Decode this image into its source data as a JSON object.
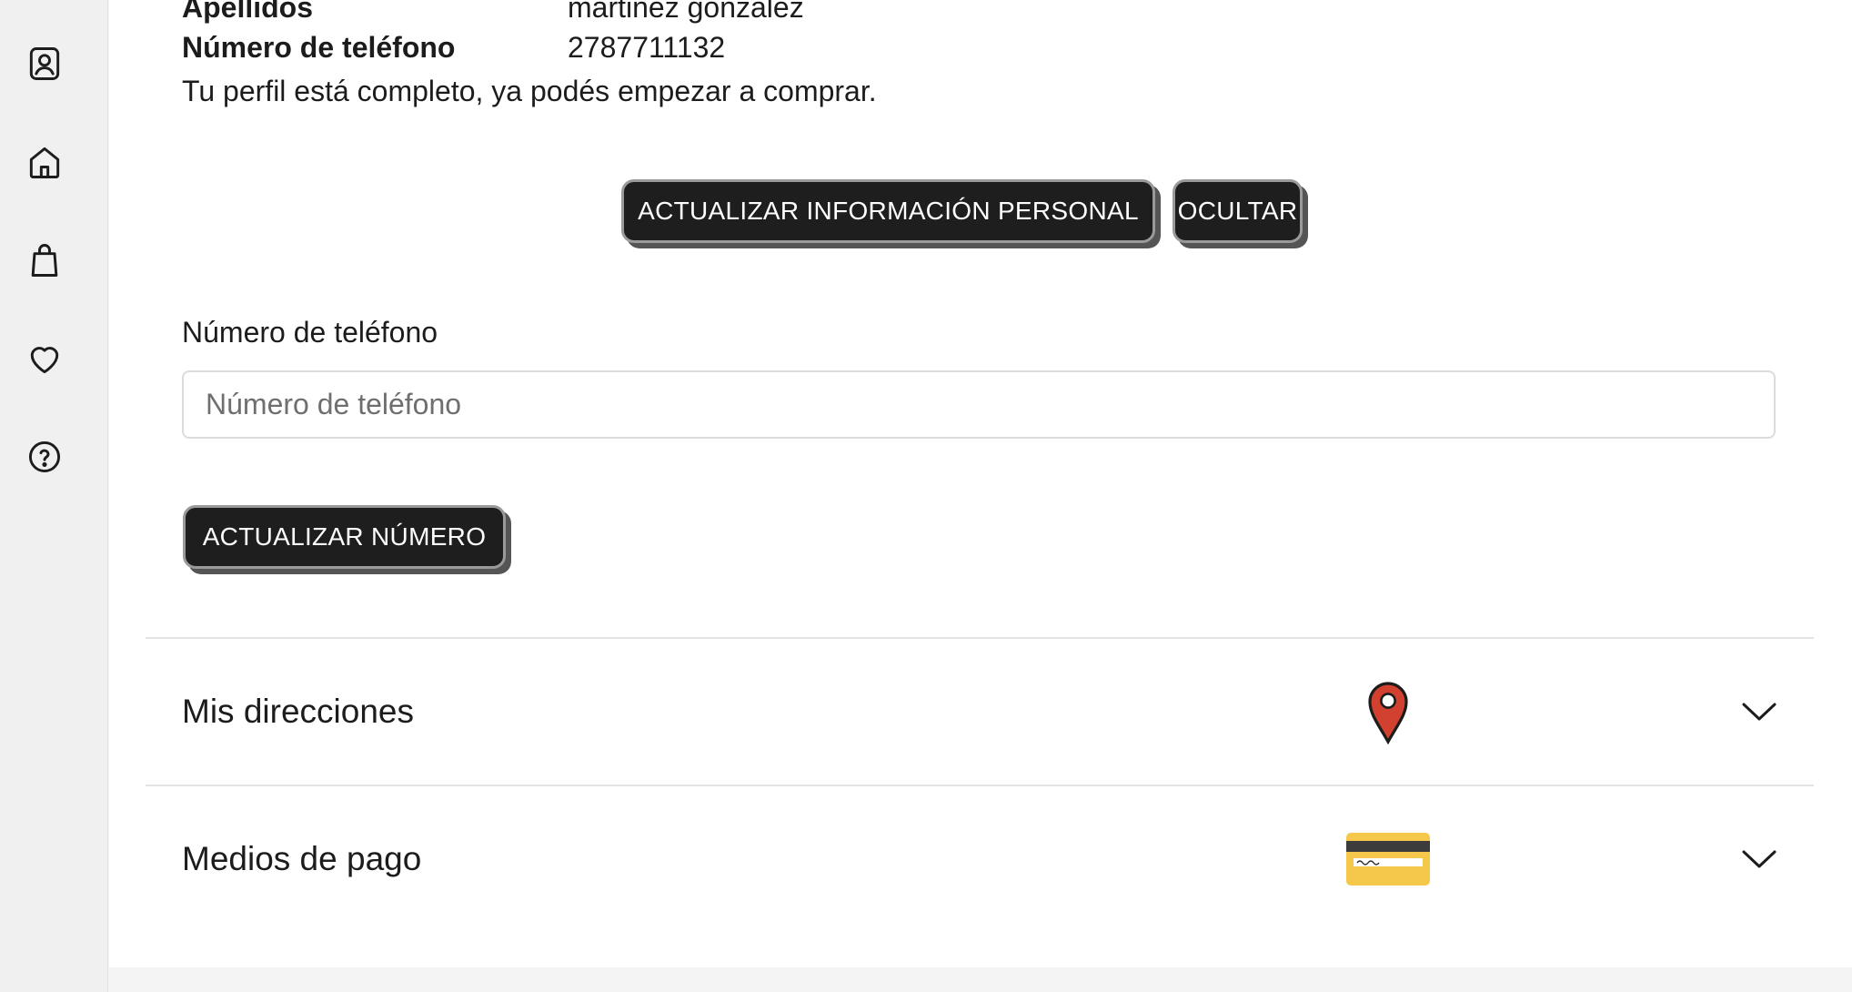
{
  "sidebar": {
    "items": [
      {
        "icon": "profile-icon"
      },
      {
        "icon": "home-icon"
      },
      {
        "icon": "shopping-bag-icon"
      },
      {
        "icon": "heart-icon"
      },
      {
        "icon": "help-icon"
      }
    ]
  },
  "profile": {
    "rows": [
      {
        "label": "Apellidos",
        "value": "martinez gonzalez"
      },
      {
        "label": "Número de teléfono",
        "value": "2787711132"
      }
    ],
    "status_message": "Tu perfil está completo, ya podés empezar a comprar."
  },
  "actions": {
    "update_personal_info_label": "ACTUALIZAR INFORMACIÓN PERSONAL",
    "hide_label": "OCULTAR"
  },
  "phone_form": {
    "label": "Número de teléfono",
    "value": "",
    "placeholder": "Número de teléfono",
    "submit_label": "ACTUALIZAR NÚMERO"
  },
  "sections": [
    {
      "title": "Mis direcciones",
      "icon": "map-pin-icon",
      "icon_color": "#d2412f"
    },
    {
      "title": "Medios de pago",
      "icon": "credit-card-icon",
      "icon_color": "#f5c84c"
    }
  ],
  "colors": {
    "button_bg": "#1e1e1e",
    "button_text": "#ffffff",
    "sidebar_bg": "#f0f0f0"
  }
}
